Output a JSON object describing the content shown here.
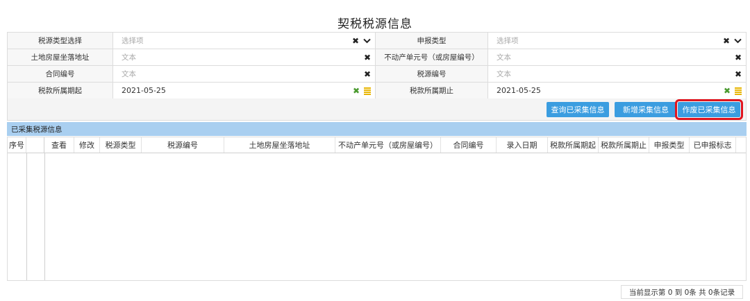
{
  "page": {
    "title": "契税税源信息"
  },
  "form": {
    "rows": [
      {
        "left_label": "税源类型选择",
        "left_value": "选择项",
        "right_label": "申报类型",
        "right_value": "选择项"
      },
      {
        "left_label": "土地房屋坐落地址",
        "left_value": "文本",
        "right_label": "不动产单元号（或房屋编号）",
        "right_value": "文本"
      },
      {
        "left_label": "合同编号",
        "left_value": "文本",
        "right_label": "税源编号",
        "right_value": "文本"
      },
      {
        "left_label": "税款所属期起",
        "left_value": "2021-05-25",
        "right_label": "税款所属期止",
        "right_value": "2021-05-25"
      }
    ]
  },
  "buttons": {
    "query": "查询已采集信息",
    "add": "新增采集信息",
    "void": "作废已采集信息"
  },
  "section": {
    "title": "已采集税源信息"
  },
  "table": {
    "columns": [
      "序号",
      "",
      "查看",
      "修改",
      "税源类型",
      "税源编号",
      "土地房屋坐落地址",
      "不动产单元号（或房屋编号）",
      "合同编号",
      "录入日期",
      "税款所属期起",
      "税款所属期止",
      "申报类型",
      "已申报标志"
    ],
    "rows": []
  },
  "pagination": {
    "summary": "当前显示第  0 到  0条 共  0条记录"
  },
  "colors": {
    "accent": "#3b9de0",
    "highlight": "#e0141e",
    "section_bg": "#a9cff0"
  },
  "icons": [
    "clear-icon",
    "chevron-down-icon",
    "confirm-icon",
    "calendar-icon"
  ]
}
